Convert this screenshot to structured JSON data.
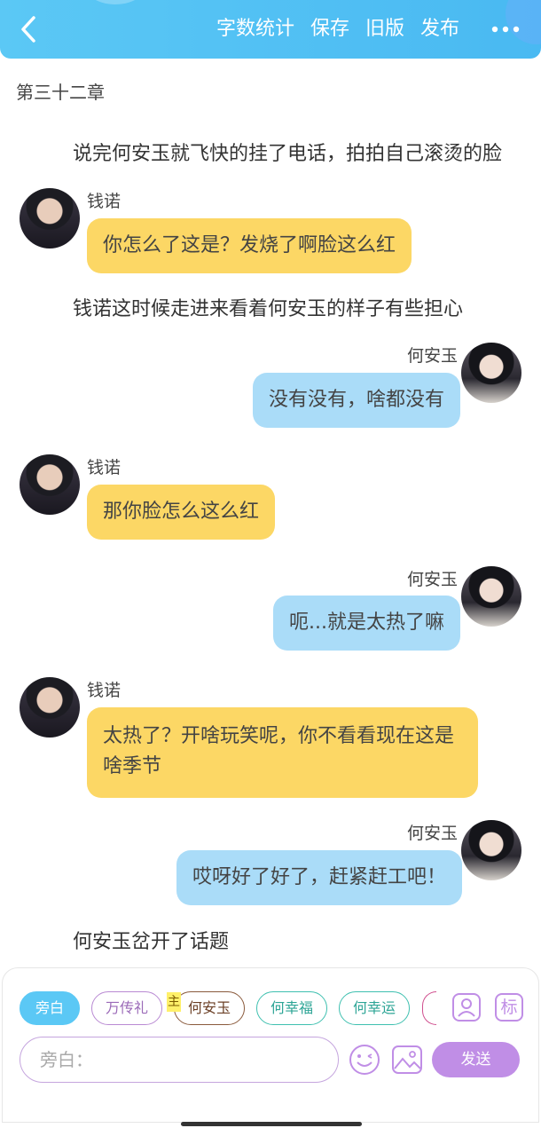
{
  "header": {
    "actions": [
      "字数统计",
      "保存",
      "旧版",
      "发布"
    ]
  },
  "chapter_title": "第三十二章",
  "messages": [
    {
      "type": "narration",
      "text": "说完何安玉就飞快的挂了电话，拍拍自己滚烫的脸"
    },
    {
      "type": "left",
      "name": "钱诺",
      "text": "你怎么了这是？发烧了啊脸这么红"
    },
    {
      "type": "narration",
      "text": "钱诺这时候走进来看着何安玉的样子有些担心"
    },
    {
      "type": "right",
      "name": "何安玉",
      "text": "没有没有，啥都没有"
    },
    {
      "type": "left",
      "name": "钱诺",
      "text": "那你脸怎么这么红"
    },
    {
      "type": "right",
      "name": "何安玉",
      "text": "呃...就是太热了嘛"
    },
    {
      "type": "left",
      "name": "钱诺",
      "text_line1": "太热了？开啥玩笑呢，你不看看现在这是",
      "text_line2": "啥季节"
    },
    {
      "type": "right",
      "name": "何安玉",
      "text": "哎呀好了好了，赶紧赶工吧！"
    },
    {
      "type": "narration",
      "text": "何安玉岔开了话题"
    }
  ],
  "composer": {
    "roles": [
      "旁白",
      "万传礼",
      "何安玉",
      "何幸福",
      "何幸运"
    ],
    "main_badge": "主",
    "tag_button": "标",
    "input_placeholder": "旁白：",
    "send_label": "发送"
  },
  "colors": {
    "header": "#49b9f2",
    "left_bubble": "#fcd765",
    "right_bubble": "#aadcf8",
    "send_button": "#c08ee6"
  }
}
